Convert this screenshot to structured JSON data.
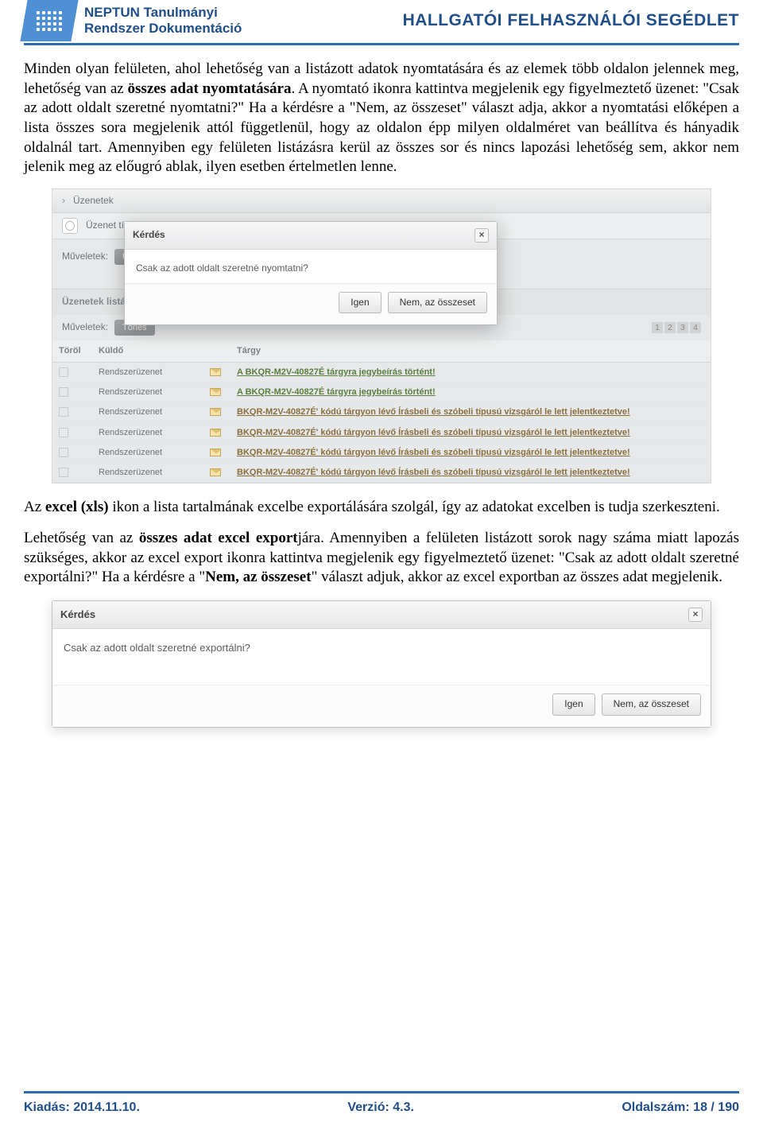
{
  "header": {
    "title_line1": "NEPTUN Tanulmányi",
    "title_line2": "Rendszer Dokumentáció",
    "right": "HALLGATÓI FELHASZNÁLÓI SEGÉDLET"
  },
  "para1_a": "Minden olyan felületen, ahol lehetőség van a listázott adatok nyomtatására és az elemek több oldalon jelennek meg, lehetőség van az ",
  "para1_b_bold": "összes adat nyomtatására",
  "para1_c": ". A nyomtató ikonra kattintva megjelenik egy figyelmeztető üzenet: \"Csak az adott oldalt szeretné nyomtatni?\" Ha a kérdésre a \"Nem, az összeset\" választ adja, akkor a nyomtatási előképen a lista összes sora megjelenik attól függetlenül, hogy az oldalon épp milyen oldalméret van beállítva és hányadik oldalnál tart. Amennyiben egy felületen listázásra kerül az összes sor és nincs lapozási lehetőség sem, akkor nem jelenik meg az előugró ablak, ilyen esetben értelmetlen lenne.",
  "ss1": {
    "toprow_label": "Üzenetek",
    "filter_label": "Üzenet típusok",
    "ops_label": "Műveletek:",
    "ops_btn": "Új ü…",
    "list_title": "Üzenetek listája",
    "ops2_label": "Műveletek:",
    "ops2_btn": "Törlés",
    "pager": [
      "1",
      "2",
      "3",
      "4"
    ],
    "columns": [
      "Töröl",
      "Küldő",
      "",
      "Tárgy"
    ],
    "rows": [
      {
        "sender": "Rendszerüzenet",
        "subject": "A BKQR-M2V-40827É tárgyra jegybeírás történt!",
        "class": "link"
      },
      {
        "sender": "Rendszerüzenet",
        "subject": "A BKQR-M2V-40827É tárgyra jegybeírás történt!",
        "class": "link"
      },
      {
        "sender": "Rendszerüzenet",
        "subject": "BKQR-M2V-40827É' kódú tárgyon lévő Írásbeli és szóbeli típusú vizsgáról le lett jelentkeztetve!",
        "class": "link2"
      },
      {
        "sender": "Rendszerüzenet",
        "subject": "BKQR-M2V-40827É' kódú tárgyon lévő Írásbeli és szóbeli típusú vizsgáról le lett jelentkeztetve!",
        "class": "link2"
      },
      {
        "sender": "Rendszerüzenet",
        "subject": "BKQR-M2V-40827É' kódú tárgyon lévő Írásbeli és szóbeli típusú vizsgáról le lett jelentkeztetve!",
        "class": "link2"
      },
      {
        "sender": "Rendszerüzenet",
        "subject": "BKQR-M2V-40827É' kódú tárgyon lévő Írásbeli és szóbeli típusú vizsgáról le lett jelentkeztetve!",
        "class": "link2"
      }
    ],
    "dialog": {
      "title": "Kérdés",
      "body": "Csak az adott oldalt szeretné nyomtatni?",
      "yes": "Igen",
      "no": "Nem, az összeset"
    }
  },
  "para2_a": "Az ",
  "para2_b_bold": "excel (xls)",
  "para2_c": " ikon a lista tartalmának excelbe exportálására szolgál, így az adatokat excelben is tudja szerkeszteni.",
  "para3_a": "Lehetőség van az ",
  "para3_b_bold": "összes adat excel export",
  "para3_c": "jára. Amennyiben a felületen listázott sorok nagy száma miatt lapozás szükséges, akkor az excel export ikonra kattintva megjelenik egy figyelmeztető üzenet: \"Csak az adott oldalt szeretné exportálni?\" Ha a kérdésre a \"",
  "para3_d_bold": "Nem, az összeset",
  "para3_e": "\" választ adjuk, akkor az excel exportban az összes adat megjelenik.",
  "ss2": {
    "title": "Kérdés",
    "body": "Csak az adott oldalt szeretné exportálni?",
    "yes": "Igen",
    "no": "Nem, az összeset"
  },
  "footer": {
    "left": "Kiadás: 2014.11.10.",
    "center": "Verzió: 4.3.",
    "right": "Oldalszám: 18 / 190"
  }
}
